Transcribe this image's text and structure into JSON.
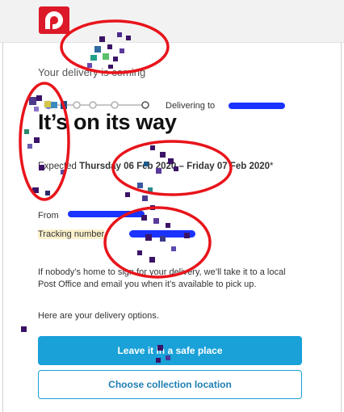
{
  "status_text": "Your delivery is coming",
  "progress": {
    "delivering_label": "Delivering to"
  },
  "title": "It’s on its way",
  "expected": {
    "prefix": "Expected ",
    "date_range": "Thursday 06 Feb 2020 – Friday 07 Feb 2020",
    "suffix": "*"
  },
  "from_label": "From",
  "tracking_label": "Tracking number",
  "info_text": "If nobody’s home to sign for your delivery, we’ll take it to a local Post Office and email you when it’s available to pick up.",
  "options_text": "Here are your delivery options.",
  "buttons": {
    "primary": "Leave it in a safe place",
    "secondary": "Choose collection location"
  },
  "colors": {
    "brand_red": "#dc1928",
    "button_blue": "#19a1d8",
    "annotation_red": "#e8141b",
    "redaction_blue": "#1a33ff",
    "pixel_purple": "#3b1366"
  },
  "icons": [
    "australia-post-logo-icon"
  ]
}
